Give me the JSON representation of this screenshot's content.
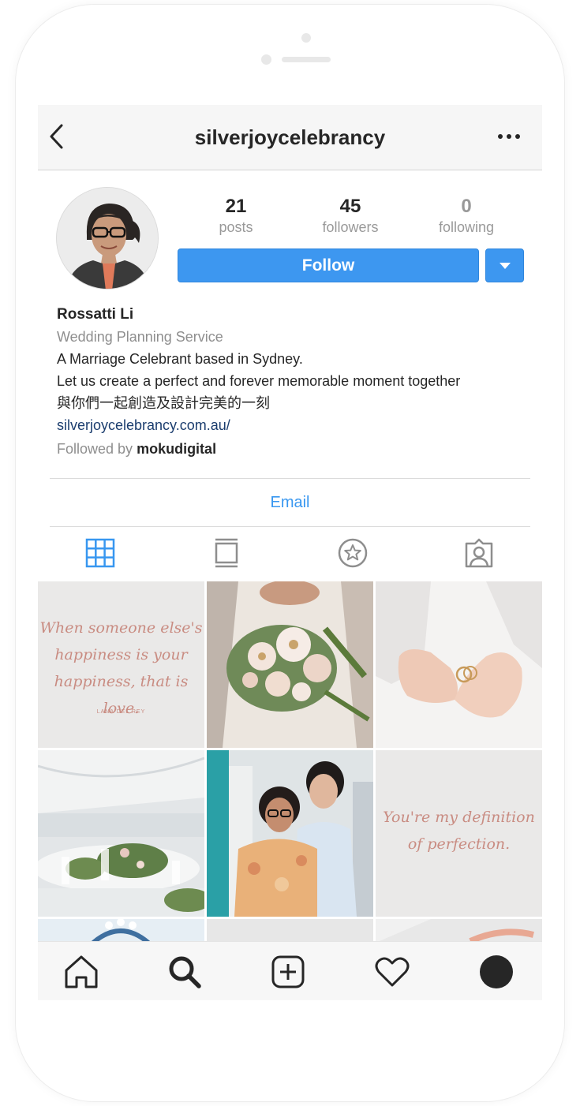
{
  "header": {
    "username": "silverjoycelebrancy",
    "back_icon": "chevron-left-icon",
    "more_icon": "more-horizontal-icon"
  },
  "stats": {
    "posts": {
      "count": "21",
      "label": "posts"
    },
    "followers": {
      "count": "45",
      "label": "followers"
    },
    "following": {
      "count": "0",
      "label": "following"
    }
  },
  "actions": {
    "follow_label": "Follow",
    "dropdown_icon": "caret-down-icon"
  },
  "bio": {
    "name": "Rossatti Li",
    "category": "Wedding Planning Service",
    "lines": [
      "A Marriage Celebrant based in Sydney.",
      "Let us create a perfect and forever memorable moment together",
      "與你們一起創造及設計完美的一刻"
    ],
    "website": "silverjoycelebrancy.com.au/",
    "followed_by_prefix": "Followed by ",
    "followed_by_user": "mokudigital"
  },
  "contact": {
    "email_label": "Email"
  },
  "tabs": [
    {
      "icon": "grid-icon",
      "active": true
    },
    {
      "icon": "feed-icon",
      "active": false
    },
    {
      "icon": "star-circle-icon",
      "active": false
    },
    {
      "icon": "tagged-person-icon",
      "active": false
    }
  ],
  "posts": {
    "quote_1": {
      "lines": [
        "When someone else's",
        "happiness is your",
        "happiness, that is love."
      ],
      "author": "LANA DEL REY"
    },
    "quote_2": {
      "lines": [
        "You're my definition",
        "of perfection."
      ]
    }
  },
  "bottom_nav": [
    {
      "icon": "home-icon"
    },
    {
      "icon": "search-icon"
    },
    {
      "icon": "new-post-icon"
    },
    {
      "icon": "heart-icon"
    },
    {
      "icon": "profile-icon"
    }
  ],
  "colors": {
    "accent": "#3897f0",
    "follow_button": "#3d97f0",
    "secondary_text": "#8e8e8e",
    "link": "#1b3d6e",
    "quote_text": "#c98c82"
  }
}
